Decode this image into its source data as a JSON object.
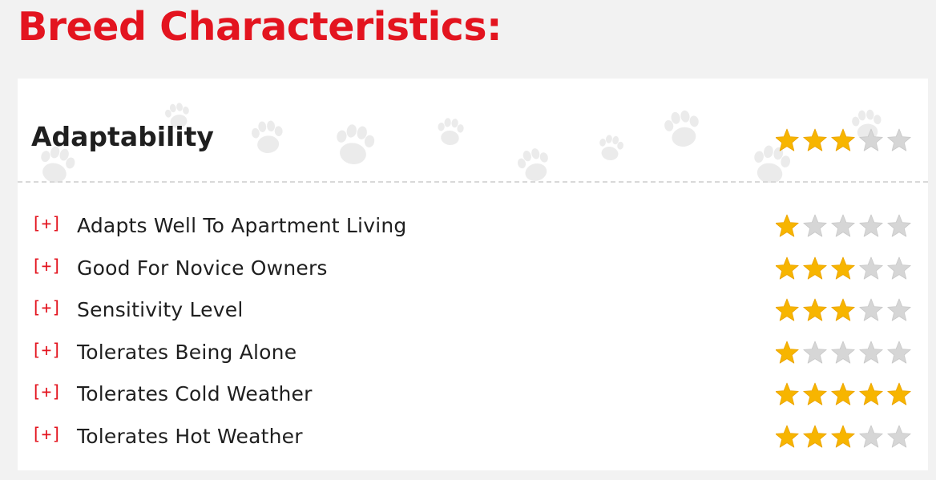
{
  "page": {
    "title": "Breed Characteristics:"
  },
  "section": {
    "title": "Adaptability",
    "rating": 3,
    "max": 5,
    "toggle_label": "[+]"
  },
  "items": [
    {
      "label": "Adapts Well To Apartment Living",
      "rating": 1
    },
    {
      "label": "Good For Novice Owners",
      "rating": 3
    },
    {
      "label": "Sensitivity Level",
      "rating": 3
    },
    {
      "label": "Tolerates Being Alone",
      "rating": 1
    },
    {
      "label": "Tolerates Cold Weather",
      "rating": 5
    },
    {
      "label": "Tolerates Hot Weather",
      "rating": 3
    }
  ],
  "icons": {
    "toggle": "expand-icon",
    "star": "star-icon",
    "background": "paw-print-icon"
  },
  "colors": {
    "title": "#e3141f",
    "toggle": "#e3141f",
    "star_filled": "#f7b500",
    "star_empty": "#d6d6d6",
    "text": "#1f1f1f",
    "paw": "#ebebeb"
  }
}
